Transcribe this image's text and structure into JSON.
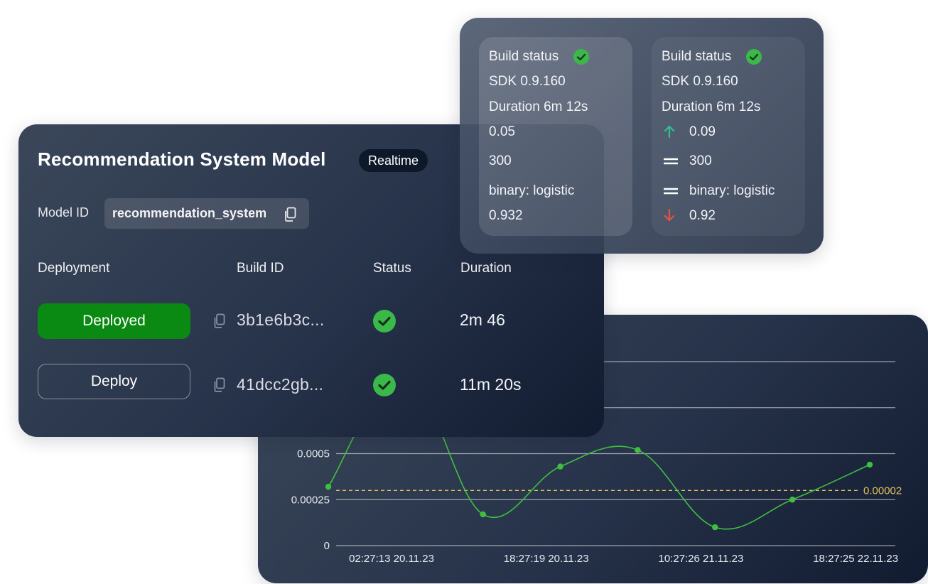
{
  "colors": {
    "line": "#3fbf3f",
    "threshold": "#e0c25a",
    "deployed": "#0a8a12",
    "ok": "#3ab94a",
    "up": "#2ec28e",
    "down": "#e5533d"
  },
  "main": {
    "title": "Recommendation System Model",
    "mode_badge": "Realtime",
    "model_id_label": "Model ID",
    "model_id": "recommendation_system",
    "columns": [
      "Deployment",
      "Build ID",
      "Status",
      "Duration"
    ],
    "rows": [
      {
        "action": "Deployed",
        "build_id": "3b1e6b3c...",
        "status": "success",
        "duration": "2m 46"
      },
      {
        "action": "Deploy",
        "build_id": "41dcc2gb...",
        "status": "success",
        "duration": "11m 20s"
      }
    ]
  },
  "builds": [
    {
      "status_label": "Build status",
      "sdk": "SDK 0.9.160",
      "duration": "Duration 6m 12s",
      "metrics": [
        {
          "value": "0.05",
          "trend": ""
        },
        {
          "value": "300",
          "trend": ""
        },
        {
          "value": "binary: logistic",
          "trend": ""
        },
        {
          "value": "0.932",
          "trend": ""
        }
      ]
    },
    {
      "status_label": "Build status",
      "sdk": "SDK 0.9.160",
      "duration": "Duration 6m 12s",
      "metrics": [
        {
          "value": "0.09",
          "trend": "up"
        },
        {
          "value": "300",
          "trend": "equal"
        },
        {
          "value": "binary: logistic",
          "trend": "equal"
        },
        {
          "value": "0.92",
          "trend": "down"
        }
      ]
    }
  ],
  "chart_data": {
    "type": "line",
    "x": [
      "02:27:13 20.11.23",
      "",
      "18:27:19 20.11.23",
      "",
      "10:27:26 21.11.23",
      "",
      "18:27:25 22.11.23",
      ""
    ],
    "x_tick_labels": [
      "02:27:13 20.11.23",
      "18:27:19 20.11.23",
      "10:27:26 21.11.23",
      "18:27:25 22.11.23"
    ],
    "series": [
      {
        "values": [
          0.00032,
          0.00093,
          0.00017,
          0.00043,
          0.00052,
          0.0001,
          0.00025,
          0.00044
        ]
      }
    ],
    "y_tick_labels": [
      "0",
      "0.00025",
      "0.0005"
    ],
    "ylim": [
      0,
      0.001
    ],
    "threshold": {
      "value": 0.0003,
      "label": "0.00002"
    },
    "grid": true
  }
}
